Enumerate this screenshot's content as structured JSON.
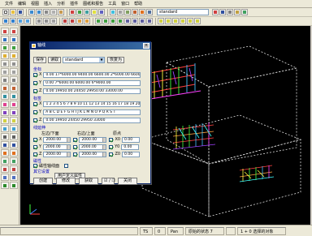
{
  "menubar": {
    "items": [
      "文件",
      "编辑",
      "视图",
      "插入",
      "分析",
      "插件",
      "图纸和报告",
      "工具",
      "窗口",
      "帮助"
    ]
  },
  "toolbar": {
    "view_combo": "standard"
  },
  "dialog": {
    "title": "轴线",
    "save_button": "保存",
    "read_button": "读取",
    "preset": "standard",
    "apply_button": "恢复为",
    "section_coords": "坐标",
    "coords": [
      {
        "axis": "X",
        "value": "0.00 17*6000.00 9400.00 6600.00 2*6000.00 6600.00"
      },
      {
        "axis": "Y",
        "value": "0.00 7*6000.00 6000.00 6*9000.00"
      },
      {
        "axis": "Z",
        "value": "0.00 19950.00 24450 29950.00 33000.00"
      }
    ],
    "section_labels": "标签",
    "labels": [
      {
        "axis": "X",
        "value": "1 2 3 4 5 6 7 8 9 10 11 12 13 14 15 16 17 18 19 20 21 22 23"
      },
      {
        "axis": "Y",
        "value": "A B C D E F G H I J K L M N O P Q R S T"
      },
      {
        "axis": "Z",
        "value": "0.00 19950 24450 29950 33000"
      }
    ],
    "section_extents": "线延伸",
    "left_bottom": "左边/下面",
    "right_top": "右边/上面",
    "origin": "原点",
    "extents": [
      {
        "axis": "X",
        "left": "2000.00",
        "right": "2000.00",
        "origin": "0.00"
      },
      {
        "axis": "Y",
        "left": "2000.00",
        "right": "2000.00",
        "origin": "0.00"
      },
      {
        "axis": "Z",
        "left": "2000.00",
        "right": "2000.00",
        "origin": "0.00"
      }
    ],
    "section_magnetic": "磁性",
    "magnetic_label": "磁性轴线面",
    "section_udas": "其它设置",
    "udas_button": "用户定义属性",
    "bottom_buttons": {
      "create": "创建",
      "modify": "修改",
      "get": "获取",
      "toggle": "☑ / ☐",
      "cancel": "关闭"
    }
  },
  "statusbar": {
    "cells": [
      "",
      "TS",
      "0",
      "Pan",
      "原始的状态 7",
      "",
      "1 + 0 选择的对象"
    ]
  }
}
